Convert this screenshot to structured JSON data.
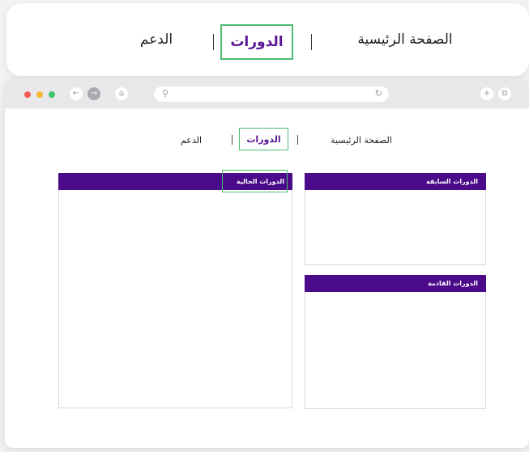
{
  "top_nav": {
    "home": "الصفحة الرئيسية",
    "courses": "الدورات",
    "support": "الدعم"
  },
  "browser": {
    "nav": {
      "home": "الصفحة الرئيسية",
      "courses": "الدورات",
      "support": "الدعم"
    },
    "panels": {
      "current": "الدورات الحالية",
      "previous": "الدورات السابقة",
      "upcoming": "الدورات القادمة"
    }
  },
  "colors": {
    "accent": "#4b0a8a",
    "highlight_border": "#4cbb73",
    "active_text": "#5a1494"
  },
  "icons": [
    "back-arrow-icon",
    "forward-arrow-icon",
    "home-icon",
    "search-icon",
    "reload-icon",
    "new-tab-icon",
    "tabs-icon"
  ]
}
